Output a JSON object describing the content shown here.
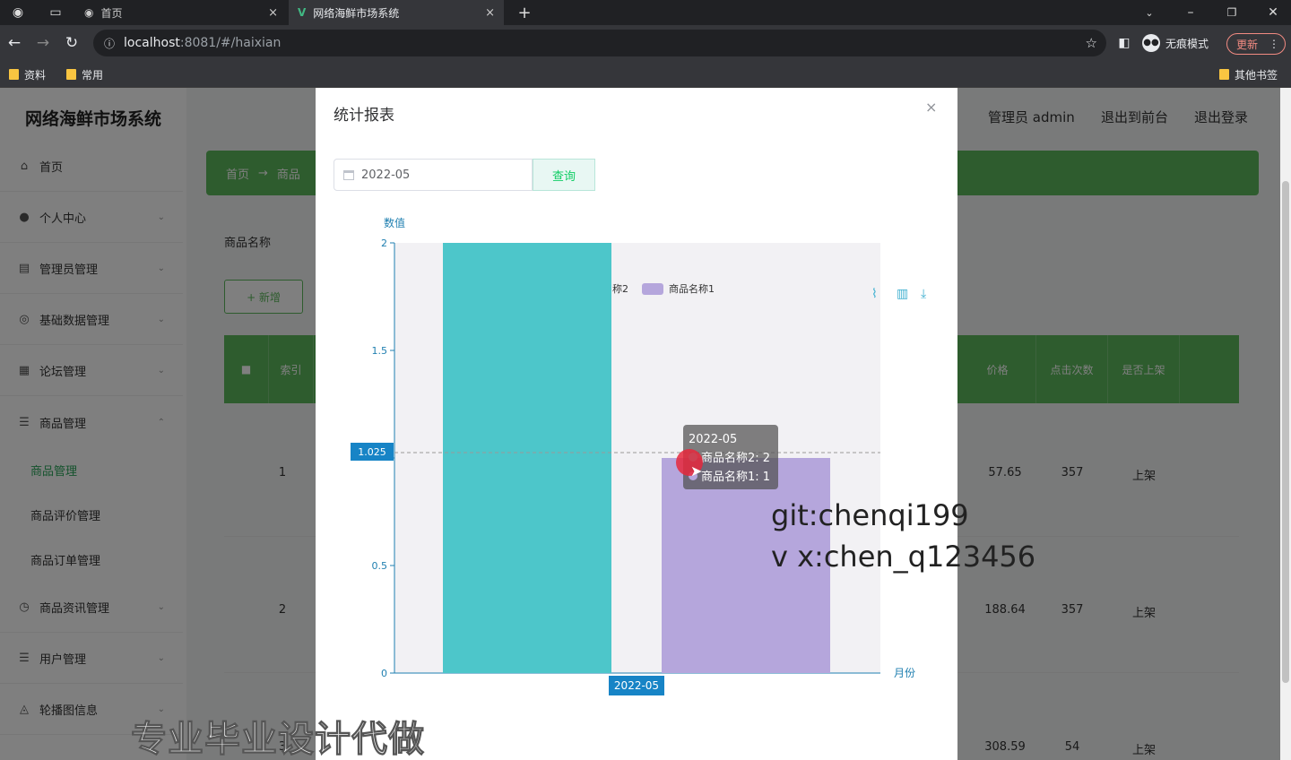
{
  "browser": {
    "tabs": [
      {
        "title": "首页"
      },
      {
        "title": "网络海鲜市场系统"
      }
    ],
    "url_host": "localhost",
    "url_rest": ":8081/#/haixian",
    "incognito_label": "无痕模式",
    "update_label": "更新",
    "bookmarks": [
      "资料",
      "常用"
    ],
    "other_bookmarks": "其他书签"
  },
  "app": {
    "title": "网络海鲜市场系统",
    "header_links": [
      "管理员 admin",
      "退出到前台",
      "退出登录"
    ],
    "breadcrumb": [
      "首页",
      "→",
      "商品"
    ],
    "menu": [
      {
        "label": "首页",
        "icon": "home-icon"
      },
      {
        "label": "个人中心",
        "icon": "user-icon"
      },
      {
        "label": "管理员管理",
        "icon": "admin-icon"
      },
      {
        "label": "基础数据管理",
        "icon": "data-icon"
      },
      {
        "label": "论坛管理",
        "icon": "forum-icon"
      },
      {
        "label": "商品管理",
        "icon": "list-icon"
      },
      {
        "label": "商品资讯管理",
        "icon": "clock-icon"
      },
      {
        "label": "用户管理",
        "icon": "list-icon"
      },
      {
        "label": "轮播图信息",
        "icon": "image-icon"
      }
    ],
    "submenu": [
      "商品管理",
      "商品评价管理",
      "商品订单管理"
    ],
    "search_label": "商品名称",
    "add_button": "+ 新增",
    "table_headers": [
      "",
      "索引",
      "价格",
      "点击次数",
      "是否上架"
    ],
    "rows": [
      {
        "index": "1",
        "price": "57.65",
        "clicks": "357",
        "status": "上架"
      },
      {
        "index": "2",
        "price": "188.64",
        "clicks": "357",
        "status": "上架"
      },
      {
        "index": "3",
        "price": "308.59",
        "clicks": "54",
        "status": "上架"
      }
    ]
  },
  "dialog": {
    "title": "统计报表",
    "close": "×",
    "date_value": "2022-05",
    "query_button": "查询"
  },
  "chart_data": {
    "type": "bar",
    "categories": [
      "2022-05"
    ],
    "series": [
      {
        "name": "商品名称2",
        "values": [
          2
        ],
        "color": "#4dc6ca"
      },
      {
        "name": "商品名称1",
        "values": [
          1
        ],
        "color": "#b5a6dc"
      }
    ],
    "xlabel": "月份",
    "ylabel": "数值",
    "ylim": [
      0,
      2
    ],
    "yticks": [
      "0",
      "0.5",
      "1",
      "1.5",
      "2"
    ],
    "legend": "top-center",
    "axis_pointer_label": "1.025",
    "category_pointer_label": "2022-05",
    "tooltip": {
      "title": "2022-05",
      "lines": [
        "商品名称2: 2",
        "商品名称1: 1"
      ]
    }
  },
  "watermarks": [
    "git:chenqi199",
    "v x:chen_q123456",
    "专业毕业设计代做"
  ]
}
